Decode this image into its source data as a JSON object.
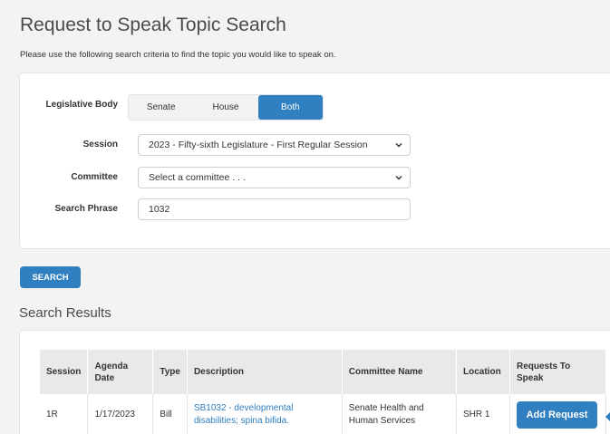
{
  "page": {
    "title": "Request to Speak Topic Search",
    "intro": "Please use the following search criteria to find the topic you would like to speak on."
  },
  "criteria": {
    "legislative_body_label": "Legislative Body",
    "legislative_body_options": [
      "Senate",
      "House",
      "Both"
    ],
    "legislative_body_selected": "Both",
    "session_label": "Session",
    "session_value": "2023 - Fifty-sixth Legislature - First Regular Session",
    "committee_label": "Committee",
    "committee_value": "Select a committee . . .",
    "search_phrase_label": "Search Phrase",
    "search_phrase_value": "1032"
  },
  "search_button": "SEARCH",
  "results": {
    "title": "Search Results",
    "headers": [
      "Session",
      "Agenda Date",
      "Type",
      "Description",
      "Committee Name",
      "Location",
      "Requests To Speak"
    ],
    "rows": [
      {
        "session": "1R",
        "agenda_date": "1/17/2023",
        "type": "Bill",
        "description": "SB1032 - developmental disabilities; spina bifida.",
        "committee": "Senate Health and Human Services",
        "location": "SHR 1",
        "action": "Add Request"
      }
    ]
  },
  "colors": {
    "accent": "#2f7fc1",
    "page_background": "#f3f3f3"
  }
}
